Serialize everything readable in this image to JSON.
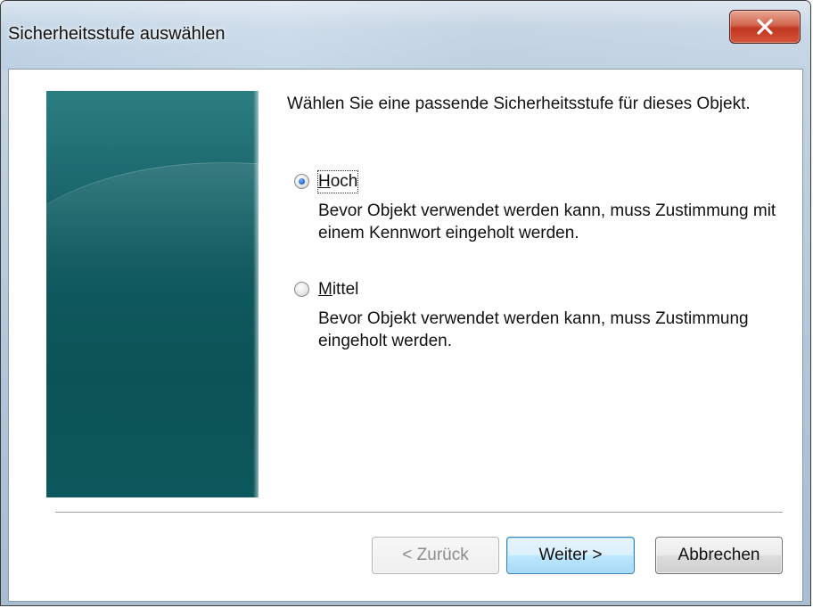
{
  "window": {
    "title": "Sicherheitsstufe auswählen",
    "close_icon": "close-x-icon"
  },
  "content": {
    "intro": "Wählen Sie eine passende Sicherheitsstufe für dieses Objekt.",
    "options": [
      {
        "label_mnemonic": "H",
        "label_rest": "och",
        "description": "Bevor Objekt verwendet werden kann, muss Zustimmung mit einem Kennwort eingeholt werden.",
        "selected": true
      },
      {
        "label_mnemonic": "M",
        "label_rest": "ittel",
        "description": "Bevor Objekt verwendet werden kann, muss Zustimmung eingeholt werden.",
        "selected": false
      }
    ]
  },
  "buttons": {
    "back": "< Zurück",
    "next": "Weiter >",
    "cancel": "Abbrechen"
  },
  "colors": {
    "banner": "#0f5a5f",
    "close_button": "#c0361f",
    "default_button_border": "#3c7fb1"
  }
}
